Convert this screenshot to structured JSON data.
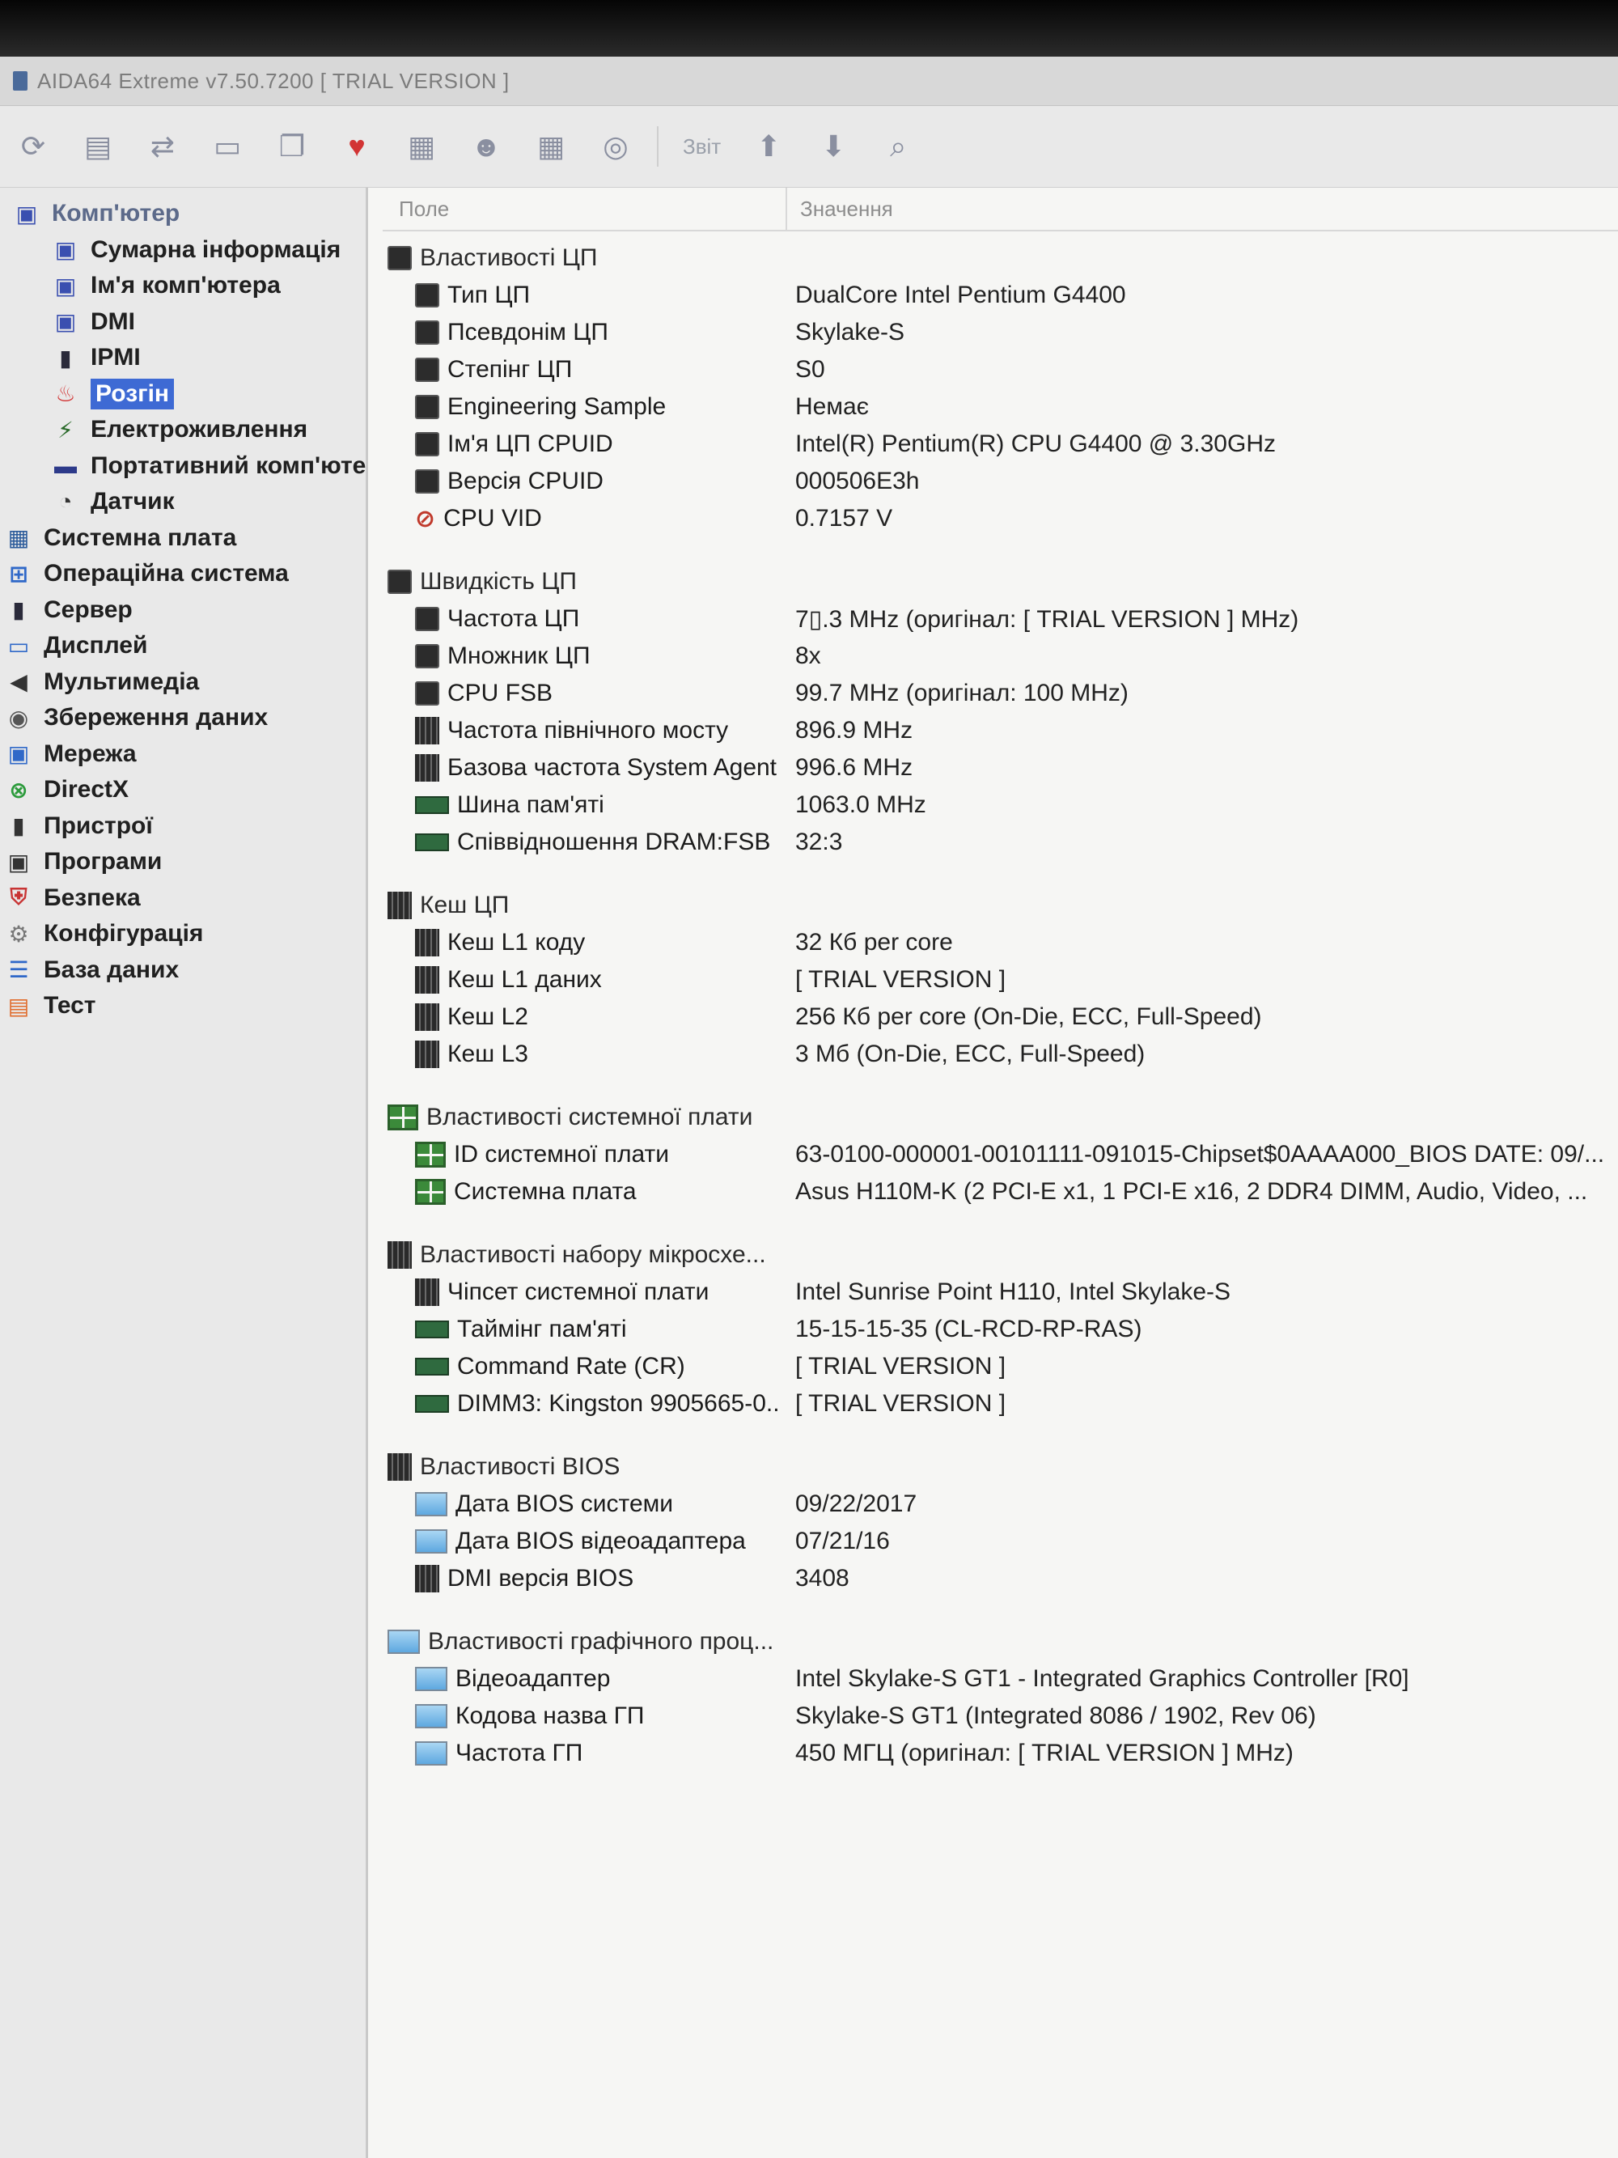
{
  "window": {
    "title": "AIDA64 Extreme v7.50.7200  [ TRIAL VERSION ]"
  },
  "toolbar": {
    "report_label": "Звіт",
    "buttons": [
      "refresh-icon",
      "report-icon",
      "network-icon",
      "screen-icon",
      "copy-icon",
      "heart-icon",
      "benchmark-icon",
      "users-icon",
      "grid-icon",
      "favorites-icon",
      "up-arrow-icon",
      "down-arrow-icon",
      "search-icon"
    ]
  },
  "sidebar": {
    "root": {
      "label": "Комп'ютер",
      "icon": "computer-icon"
    },
    "children": [
      {
        "label": "Сумарна інформація",
        "icon": "computer-icon"
      },
      {
        "label": "Ім'я комп'ютера",
        "icon": "computer-icon"
      },
      {
        "label": "DMI",
        "icon": "computer-icon"
      },
      {
        "label": "IPMI",
        "icon": "server-icon"
      },
      {
        "label": "Розгін",
        "icon": "flame-icon",
        "selected": true
      },
      {
        "label": "Електроживлення",
        "icon": "power-icon"
      },
      {
        "label": "Портативний комп'юте",
        "icon": "laptop-icon"
      },
      {
        "label": "Датчик",
        "icon": "gauge-icon"
      }
    ],
    "items": [
      {
        "label": "Системна плата",
        "icon": "motherboard-icon"
      },
      {
        "label": "Операційна система",
        "icon": "windows-icon"
      },
      {
        "label": "Сервер",
        "icon": "server-icon"
      },
      {
        "label": "Дисплей",
        "icon": "monitor-icon"
      },
      {
        "label": "Мультимедіа",
        "icon": "speaker-icon"
      },
      {
        "label": "Збереження даних",
        "icon": "disk-icon"
      },
      {
        "label": "Мережа",
        "icon": "network-icon"
      },
      {
        "label": "DirectX",
        "icon": "xbox-icon"
      },
      {
        "label": "Пристрої",
        "icon": "devices-icon"
      },
      {
        "label": "Програми",
        "icon": "programs-icon"
      },
      {
        "label": "Безпека",
        "icon": "shield-icon"
      },
      {
        "label": "Конфігурація",
        "icon": "config-icon"
      },
      {
        "label": "База даних",
        "icon": "database-icon"
      },
      {
        "label": "Тест",
        "icon": "test-icon"
      }
    ]
  },
  "columns": {
    "field": "Поле",
    "value": "Значення"
  },
  "groups": [
    {
      "title": "Властивості ЦП",
      "icon": "chip",
      "rows": [
        {
          "field": "Тип ЦП",
          "value": "DualCore Intel Pentium G4400",
          "icon": "chip"
        },
        {
          "field": "Псевдонім ЦП",
          "value": "Skylake-S",
          "icon": "chip"
        },
        {
          "field": "Степінг ЦП",
          "value": "S0",
          "icon": "chip"
        },
        {
          "field": "Engineering Sample",
          "value": "Немає",
          "icon": "chip"
        },
        {
          "field": "Ім'я ЦП CPUID",
          "value": "Intel(R) Pentium(R) CPU G4400 @ 3.30GHz",
          "icon": "chip"
        },
        {
          "field": "Версія CPUID",
          "value": "000506E3h",
          "icon": "chip"
        },
        {
          "field": "CPU VID",
          "value": "0.7157 V",
          "icon": "vid"
        }
      ]
    },
    {
      "title": "Швидкість ЦП",
      "icon": "chip",
      "rows": [
        {
          "field": "Частота ЦП",
          "value": "7▯.3 MHz  (оригінал:  [ TRIAL VERSION ] MHz)",
          "icon": "chip"
        },
        {
          "field": "Множник ЦП",
          "value": "8x",
          "icon": "chip"
        },
        {
          "field": "CPU FSB",
          "value": "99.7 MHz  (оригінал:  100 MHz)",
          "icon": "chip"
        },
        {
          "field": "Частота північного мосту",
          "value": "896.9 MHz",
          "icon": "chip-bar"
        },
        {
          "field": "Базова частота System Agent",
          "value": "996.6 MHz",
          "icon": "chip-bar"
        },
        {
          "field": "Шина пам'яті",
          "value": "1063.0 MHz",
          "icon": "ram"
        },
        {
          "field": "Співвідношення DRAM:FSB",
          "value": "32:3",
          "icon": "ram"
        }
      ]
    },
    {
      "title": "Кеш ЦП",
      "icon": "chip-bar",
      "rows": [
        {
          "field": "Кеш L1 коду",
          "value": "32 Кб per core",
          "icon": "chip-bar"
        },
        {
          "field": "Кеш L1 даних",
          "value": "[ TRIAL VERSION ]",
          "icon": "chip-bar"
        },
        {
          "field": "Кеш L2",
          "value": "256 Кб per core  (On-Die, ECC, Full-Speed)",
          "icon": "chip-bar"
        },
        {
          "field": "Кеш L3",
          "value": "3 Мб  (On-Die, ECC, Full-Speed)",
          "icon": "chip-bar"
        }
      ]
    },
    {
      "title": "Властивості системної плати",
      "icon": "board",
      "rows": [
        {
          "field": "ID системної плати",
          "value": "63-0100-000001-00101111-091015-Chipset$0AAAA000_BIOS DATE: 09/...",
          "icon": "board"
        },
        {
          "field": "Системна плата",
          "value": "Asus H110M-K  (2 PCI-E x1, 1 PCI-E x16, 2 DDR4 DIMM, Audio, Video, ...",
          "icon": "board"
        }
      ]
    },
    {
      "title": "Властивості набору мікросхе...",
      "icon": "chip-bar",
      "rows": [
        {
          "field": "Чіпсет системної плати",
          "value": "Intel Sunrise Point H110, Intel Skylake-S",
          "icon": "chip-bar"
        },
        {
          "field": "Таймінг пам'яті",
          "value": "15-15-15-35  (CL-RCD-RP-RAS)",
          "icon": "ram"
        },
        {
          "field": "Command Rate (CR)",
          "value": "[ TRIAL VERSION ]",
          "icon": "ram"
        },
        {
          "field": "DIMM3: Kingston 9905665-0...",
          "value": "[ TRIAL VERSION ]",
          "icon": "ram"
        }
      ]
    },
    {
      "title": "Властивості BIOS",
      "icon": "chip-bar",
      "rows": [
        {
          "field": "Дата BIOS системи",
          "value": "09/22/2017",
          "icon": "monitor"
        },
        {
          "field": "Дата BIOS відеоадаптера",
          "value": "07/21/16",
          "icon": "monitor"
        },
        {
          "field": "DMI версія BIOS",
          "value": "3408",
          "icon": "chip-bar"
        }
      ]
    },
    {
      "title": "Властивості графічного проц...",
      "icon": "monitor",
      "rows": [
        {
          "field": "Відеоадаптер",
          "value": "Intel Skylake-S GT1 - Integrated Graphics Controller [R0]",
          "icon": "monitor"
        },
        {
          "field": "Кодова назва ГП",
          "value": "Skylake-S GT1  (Integrated 8086 / 1902, Rev 06)",
          "icon": "monitor"
        },
        {
          "field": "Частота ГП",
          "value": "450 МГЦ  (оригінал:  [ TRIAL VERSION ] MHz)",
          "icon": "monitor"
        }
      ]
    }
  ]
}
